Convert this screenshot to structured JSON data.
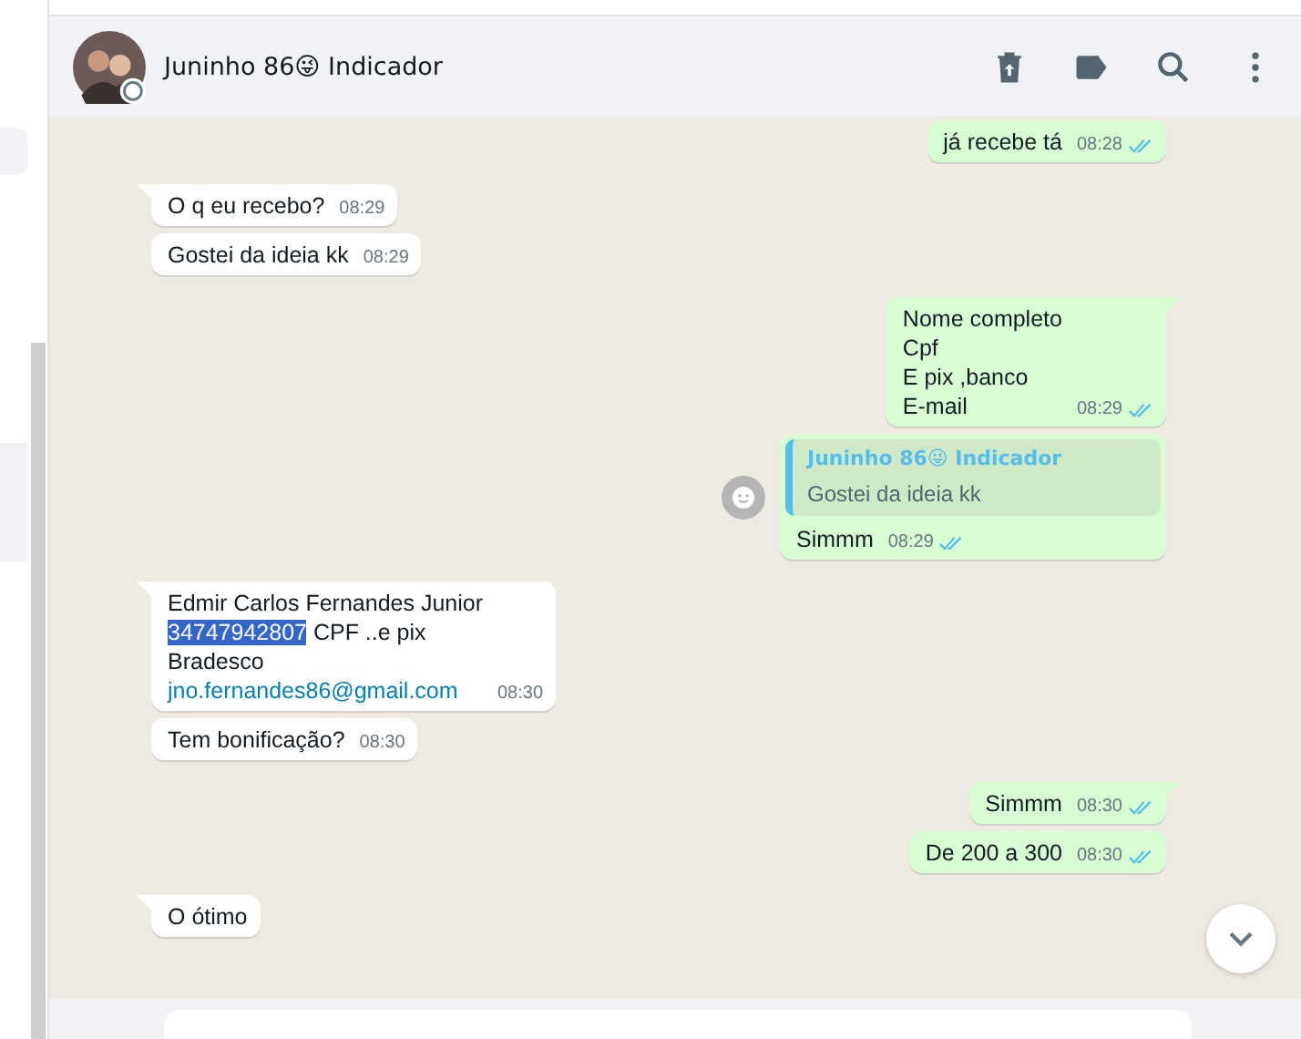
{
  "header": {
    "title": "Juninho 86😜 Indicador"
  },
  "messages": [
    {
      "kind": "out",
      "tail": false,
      "parts": [
        {
          "text": "já recebe tá"
        }
      ],
      "time": "08:28",
      "read": true
    },
    {
      "kind": "in",
      "tail": true,
      "parts": [
        {
          "text": "O q eu recebo?"
        }
      ],
      "time": "08:29"
    },
    {
      "kind": "in",
      "tail": false,
      "parts": [
        {
          "text": "Gostei da ideia kk"
        }
      ],
      "time": "08:29"
    },
    {
      "kind": "out",
      "tail": true,
      "parts": [
        {
          "text": "Nome completo\nCpf\nE pix ,banco\nE-mail"
        }
      ],
      "time": "08:29",
      "read": true
    },
    {
      "kind": "out",
      "tail": false,
      "reaction_button": true,
      "quote": {
        "author": "Juninho 86😜 Indicador",
        "text": "Gostei da ideia kk"
      },
      "parts": [
        {
          "text": "Simmm"
        }
      ],
      "time": "08:29",
      "read": true
    },
    {
      "kind": "in",
      "tail": true,
      "parts": [
        {
          "text": "Edmir Carlos Fernandes Junior\n"
        },
        {
          "text": "34747942807",
          "selected": true
        },
        {
          "text": " CPF ..e pix\nBradesco\n"
        },
        {
          "text": "jno.fernandes86@gmail.com",
          "link": true
        }
      ],
      "time": "08:30"
    },
    {
      "kind": "in",
      "tail": false,
      "parts": [
        {
          "text": "Tem bonificação?"
        }
      ],
      "time": "08:30"
    },
    {
      "kind": "out",
      "tail": true,
      "parts": [
        {
          "text": "Simmm"
        }
      ],
      "time": "08:30",
      "read": true
    },
    {
      "kind": "out",
      "tail": false,
      "parts": [
        {
          "text": "De 200 a 300"
        }
      ],
      "time": "08:30",
      "read": true
    },
    {
      "kind": "in",
      "tail": true,
      "parts": [
        {
          "text": "O ótimo"
        }
      ]
    }
  ]
}
